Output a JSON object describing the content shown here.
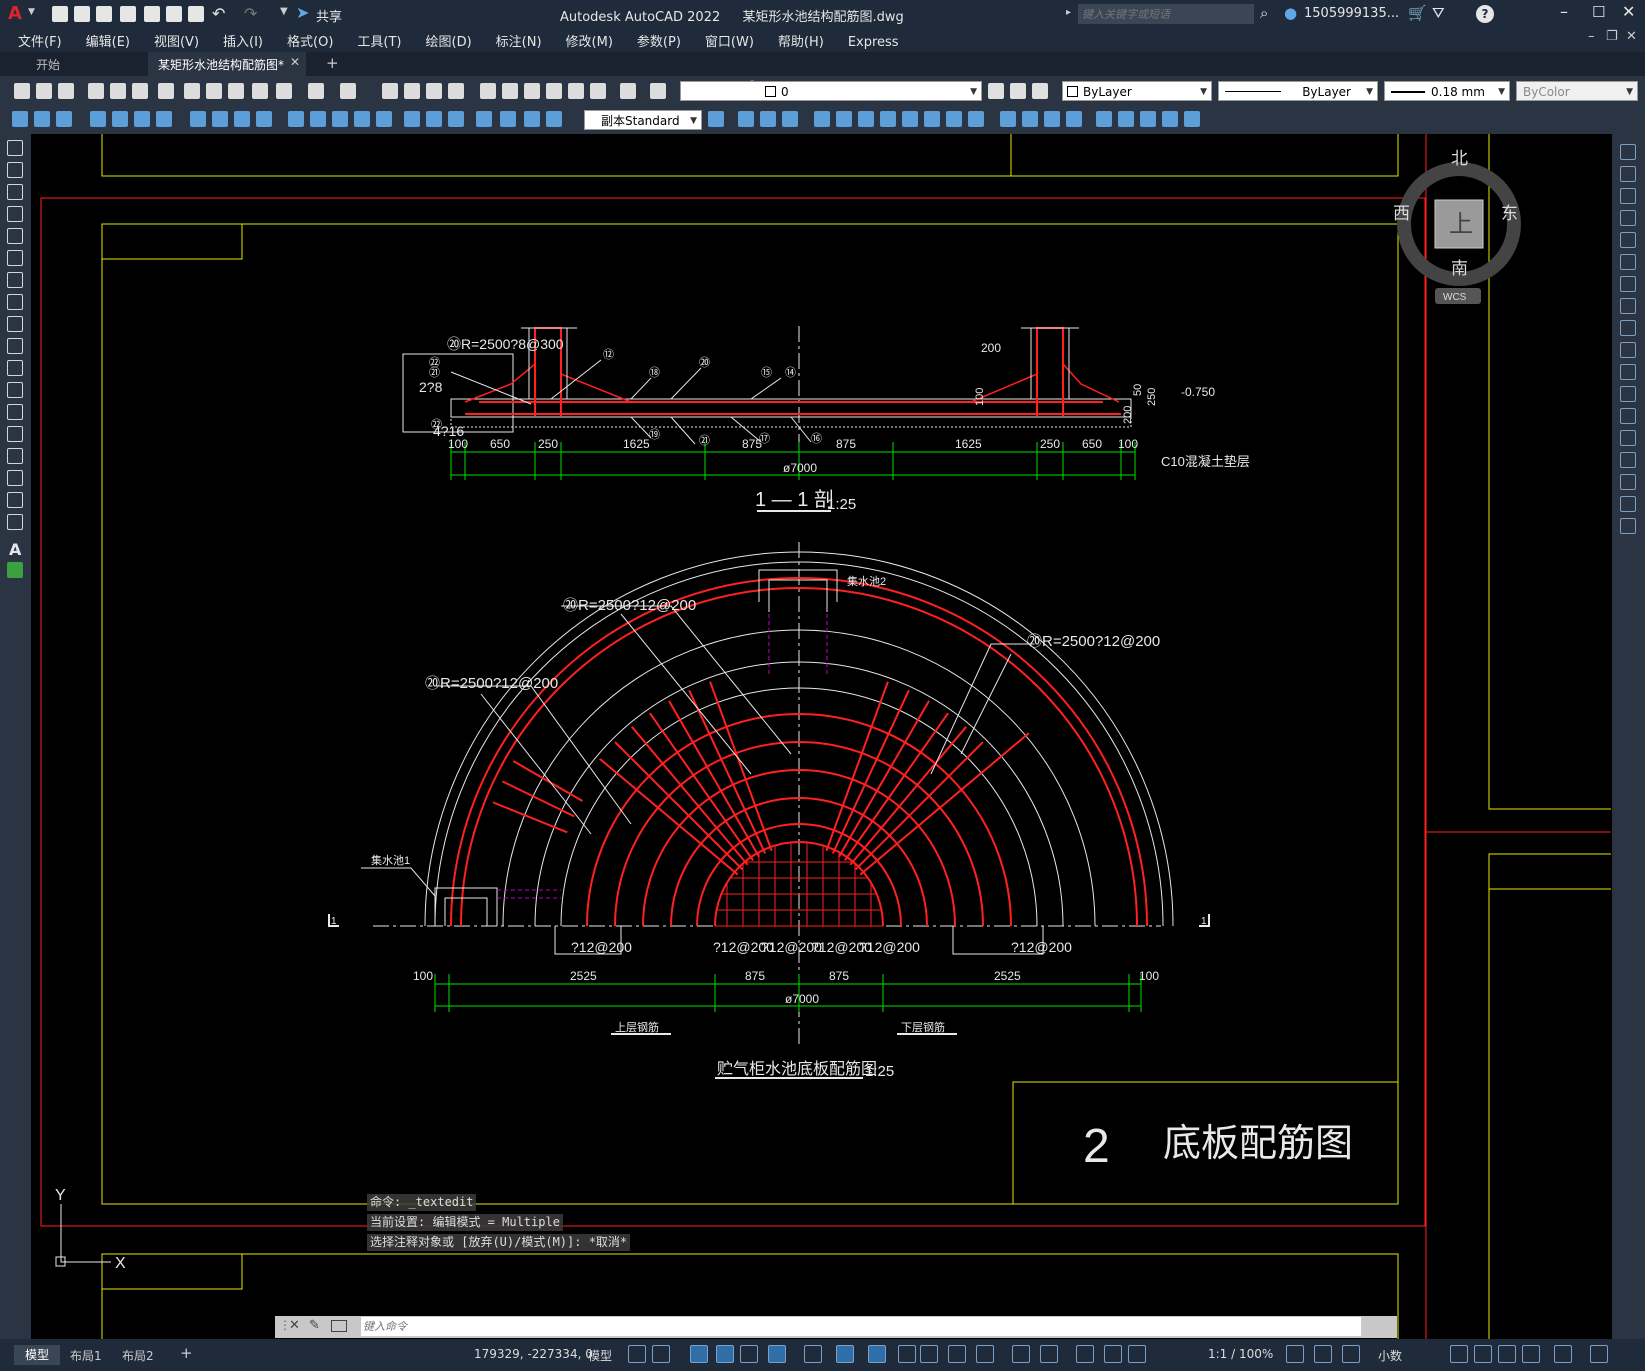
{
  "titlebar": {
    "app_title": "Autodesk AutoCAD 2022",
    "file_name": "某矩形水池结构配筋图.dwg",
    "share_label": "共享",
    "search_placeholder": "键入关键字或短语",
    "user_name": "1505999135...",
    "app_letter": "A"
  },
  "menubar": {
    "items": [
      "文件(F)",
      "编辑(E)",
      "视图(V)",
      "插入(I)",
      "格式(O)",
      "工具(T)",
      "绘图(D)",
      "标注(N)",
      "修改(M)",
      "参数(P)",
      "窗口(W)",
      "帮助(H)",
      "Express"
    ]
  },
  "tabs": {
    "items": [
      "开始",
      "某矩形水池结构配筋图*"
    ],
    "active": 1
  },
  "toolbar": {
    "layer_value": "0",
    "color_value": "ByLayer",
    "linetype_value": "ByLayer",
    "lineweight_value": "0.18 mm",
    "plotstyle_value": "ByColor",
    "textstyle_value": "副本Standard"
  },
  "viewcube": {
    "north": "北",
    "south": "南",
    "east": "东",
    "west": "西",
    "top": "上",
    "wcs": "WCS"
  },
  "drawing": {
    "section": {
      "label_tl": "⑳R=2500?8@300",
      "label_28": "2?8",
      "label_216": "4?16",
      "label_200": "200",
      "label_50": "50",
      "label_100v": "100",
      "label_200v": "200",
      "label_250v": "250",
      "elev": "-0.750",
      "c10": "C10混凝土垫层",
      "dims": [
        "100",
        "650",
        "250",
        "1625",
        "875",
        "875",
        "1625",
        "250",
        "650",
        "100"
      ],
      "overall": "ø7000",
      "title": "1 — 1 剖",
      "scale": "1:25",
      "nums": [
        "㉑",
        "㉒",
        "㉒",
        "⑫",
        "⑱",
        "⑳",
        "⑮",
        "⑭",
        "⑲",
        "㉑",
        "⑰",
        "⑯"
      ]
    },
    "plan": {
      "label_jsc2": "集水池2",
      "label_jsc1": "集水池1",
      "rebar1": "⑳R=2500?12@200",
      "rebar2": "⑳R=2500?12@200",
      "rebar3": "⑳R=2500?12@200",
      "b1": "?12@200",
      "b2": "?12@200",
      "b3": "?12@200",
      "b4": "?12@200",
      "b5": "?12@200",
      "dims": [
        "100",
        "2525",
        "875",
        "875",
        "2525",
        "100"
      ],
      "overall": "ø7000",
      "upper": "上层钢筋",
      "lower": "下层钢筋",
      "title": "贮气柜水池底板配筋图",
      "scale": "1:25",
      "cut1": "1",
      "cut2": "1"
    },
    "titleblock": {
      "number": "2",
      "name": "底板配筋图"
    }
  },
  "ucs": {
    "x": "X",
    "y": "Y"
  },
  "command": {
    "history": [
      "命令: _textedit",
      "当前设置: 编辑模式 = Multiple",
      "选择注释对象或 [放弃(U)/模式(M)]: *取消*"
    ],
    "placeholder": "键入命令"
  },
  "status": {
    "tabs": [
      "模型",
      "布局1",
      "布局2"
    ],
    "coords": "179329, -227334, 0",
    "model": "模型",
    "scale": "1:1 / 100%",
    "units": "小数"
  },
  "colors": {
    "red": "#ff2020",
    "yellow": "#e6e600",
    "green": "#00e000",
    "white": "#e8e8e8",
    "magenta": "#c000c0"
  }
}
